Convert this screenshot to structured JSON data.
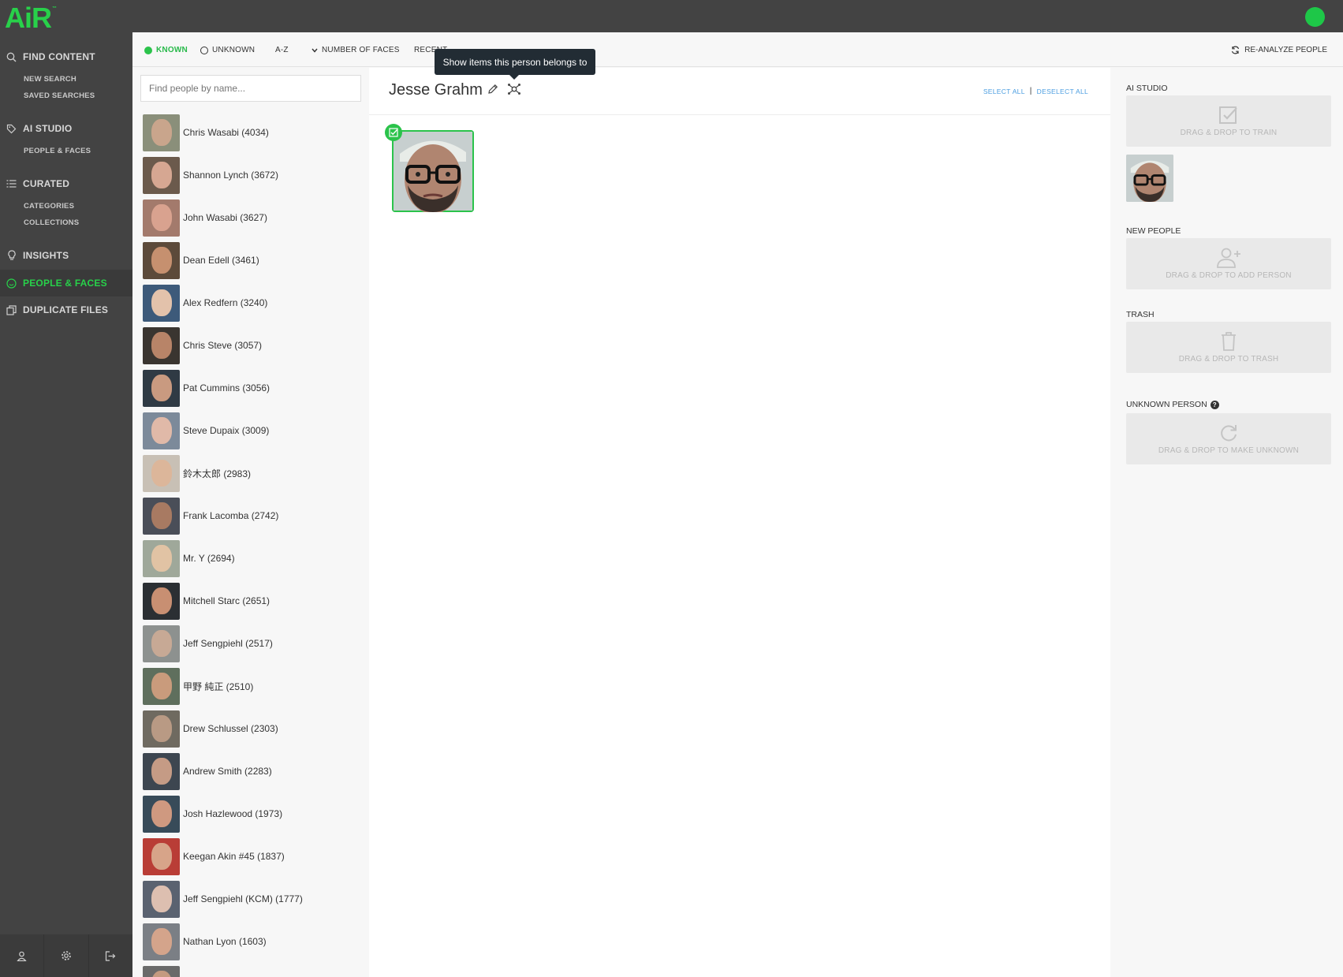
{
  "app": {
    "logo": "AiR",
    "logo_mark": "™"
  },
  "sidebar": {
    "sections": [
      {
        "label": "FIND CONTENT",
        "icon": "search-icon",
        "items": [
          "NEW SEARCH",
          "SAVED SEARCHES"
        ]
      },
      {
        "label": "AI STUDIO",
        "icon": "tag-icon",
        "items": [
          "PEOPLE & FACES"
        ]
      },
      {
        "label": "CURATED",
        "icon": "list-icon",
        "items": [
          "CATEGORIES",
          "COLLECTIONS"
        ]
      },
      {
        "label": "INSIGHTS",
        "icon": "lightbulb-icon",
        "items": []
      },
      {
        "label": "PEOPLE & FACES",
        "icon": "smiley-icon",
        "items": [],
        "active": true
      },
      {
        "label": "DUPLICATE FILES",
        "icon": "copy-icon",
        "items": []
      }
    ],
    "footer": [
      "user-icon",
      "gear-icon",
      "logout-icon"
    ]
  },
  "toolbar": {
    "known": "KNOWN",
    "unknown": "UNKNOWN",
    "az": "A-Z",
    "number_of_faces": "NUMBER OF FACES",
    "recent": "RECENT",
    "reanalyze": "RE-ANALYZE PEOPLE"
  },
  "tooltip": "Show items this person belongs to",
  "search": {
    "placeholder": "Find people by name..."
  },
  "people": [
    {
      "name": "Chris Wasabi (4034)",
      "skin": "#c9a58c",
      "bg": "#8a8f7a"
    },
    {
      "name": "Shannon Lynch (3672)",
      "skin": "#d6a792",
      "bg": "#6b5a4c"
    },
    {
      "name": "John Wasabi (3627)",
      "skin": "#d9a28f",
      "bg": "#a37a6c"
    },
    {
      "name": "Dean Edell (3461)",
      "skin": "#c6906f",
      "bg": "#5c4a3a"
    },
    {
      "name": "Alex Redfern (3240)",
      "skin": "#e3c2ab",
      "bg": "#3d5a7a"
    },
    {
      "name": "Chris Steve (3057)",
      "skin": "#b88468",
      "bg": "#3a3530"
    },
    {
      "name": "Pat Cummins (3056)",
      "skin": "#c99a80",
      "bg": "#2f3a44"
    },
    {
      "name": "Steve Dupaix (3009)",
      "skin": "#e0b9a8",
      "bg": "#7c8a9a"
    },
    {
      "name": "鈴木太郎 (2983)",
      "skin": "#dcb69a",
      "bg": "#c8c0b5"
    },
    {
      "name": "Frank Lacomba (2742)",
      "skin": "#a87a62",
      "bg": "#4a4e58"
    },
    {
      "name": "Mr. Y (2694)",
      "skin": "#e1c3a4",
      "bg": "#9fa89a"
    },
    {
      "name": "Mitchell Starc (2651)",
      "skin": "#c88f72",
      "bg": "#2b2f33"
    },
    {
      "name": "Jeff Sengpiehl (2517)",
      "skin": "#c7a995",
      "bg": "#8d918f"
    },
    {
      "name": "甲野 純正 (2510)",
      "skin": "#c99b7c",
      "bg": "#5f6f5d"
    },
    {
      "name": "Drew Schlussel (2303)",
      "skin": "#b99a84",
      "bg": "#6f6a60"
    },
    {
      "name": "Andrew Smith (2283)",
      "skin": "#c59b85",
      "bg": "#3d4650"
    },
    {
      "name": "Josh Hazlewood (1973)",
      "skin": "#cf9980",
      "bg": "#384b59"
    },
    {
      "name": "Keegan Akin #45 (1837)",
      "skin": "#d7a489",
      "bg": "#b93d36"
    },
    {
      "name": "Jeff Sengpiehl (KCM) (1777)",
      "skin": "#ddbfb0",
      "bg": "#5a6270"
    },
    {
      "name": "Nathan Lyon (1603)",
      "skin": "#d4a48b",
      "bg": "#7b7f85"
    },
    {
      "name": "",
      "skin": "#c49a80",
      "bg": "#6a6a6a"
    }
  ],
  "main": {
    "person_name": "Jesse Grahm",
    "select_all": "SELECT ALL",
    "deselect_all": "DESELECT ALL",
    "separator": "|"
  },
  "right_panel": {
    "ai_studio": {
      "label": "AI STUDIO",
      "drop": "DRAG & DROP TO TRAIN"
    },
    "new_people": {
      "label": "NEW PEOPLE",
      "drop": "DRAG & DROP TO ADD PERSON"
    },
    "trash": {
      "label": "TRASH",
      "drop": "DRAG & DROP TO TRASH"
    },
    "unknown_person": {
      "label": "UNKNOWN PERSON",
      "help": "?",
      "drop": "DRAG & DROP TO MAKE UNKNOWN"
    }
  },
  "colors": {
    "accent": "#28d14a",
    "sidebar": "#434343",
    "link": "#4a9de0",
    "tooltip": "#222c34"
  }
}
